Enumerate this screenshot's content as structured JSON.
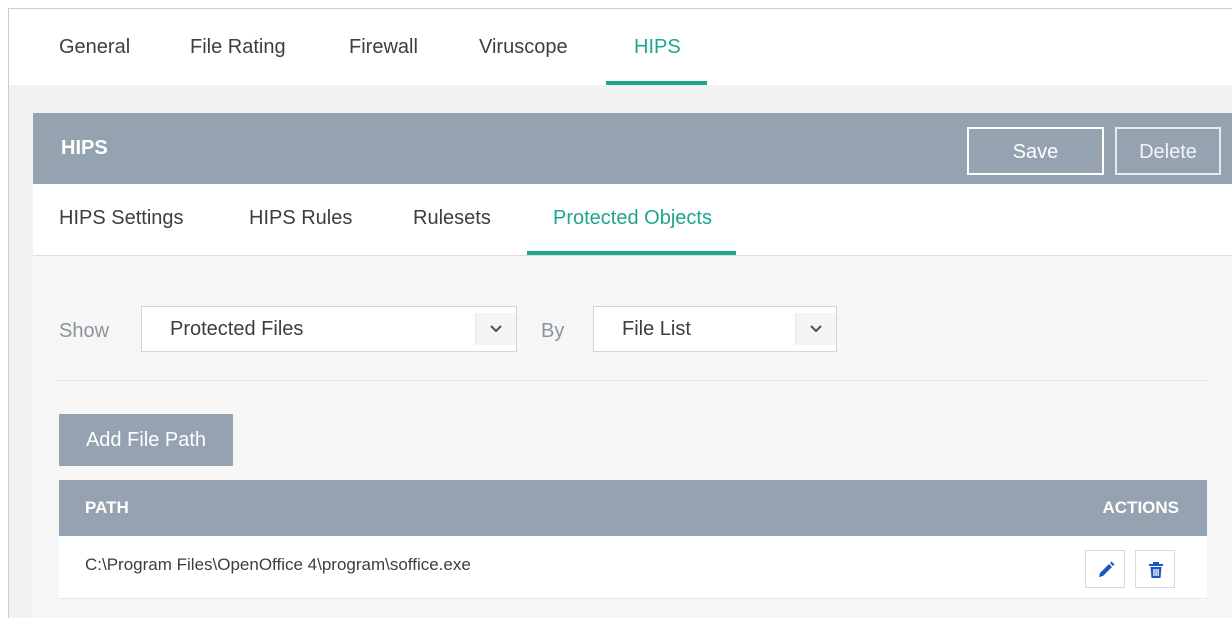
{
  "top_tabs": [
    {
      "label": "General"
    },
    {
      "label": "File Rating"
    },
    {
      "label": "Firewall"
    },
    {
      "label": "Viruscope"
    },
    {
      "label": "HIPS",
      "active": true
    }
  ],
  "hips_bar": {
    "title": "HIPS",
    "save_label": "Save",
    "delete_label": "Delete"
  },
  "sub_tabs": [
    {
      "label": "HIPS Settings"
    },
    {
      "label": "HIPS Rules"
    },
    {
      "label": "Rulesets"
    },
    {
      "label": "Protected Objects",
      "active": true
    }
  ],
  "filters": {
    "show_label": "Show",
    "show_value": "Protected Files",
    "by_label": "By",
    "by_value": "File List"
  },
  "add_button_label": "Add File Path",
  "table": {
    "columns": [
      "PATH",
      "ACTIONS"
    ],
    "rows": [
      {
        "path": "C:\\Program Files\\OpenOffice 4\\program\\soffice.exe"
      }
    ]
  },
  "colors": {
    "accent": "#1fa58b",
    "header_bar": "#94a3af",
    "action_icon": "#1a55c4"
  },
  "icons": {
    "edit": "pencil-icon",
    "delete": "trash-icon",
    "dropdown": "chevron-down-icon"
  }
}
